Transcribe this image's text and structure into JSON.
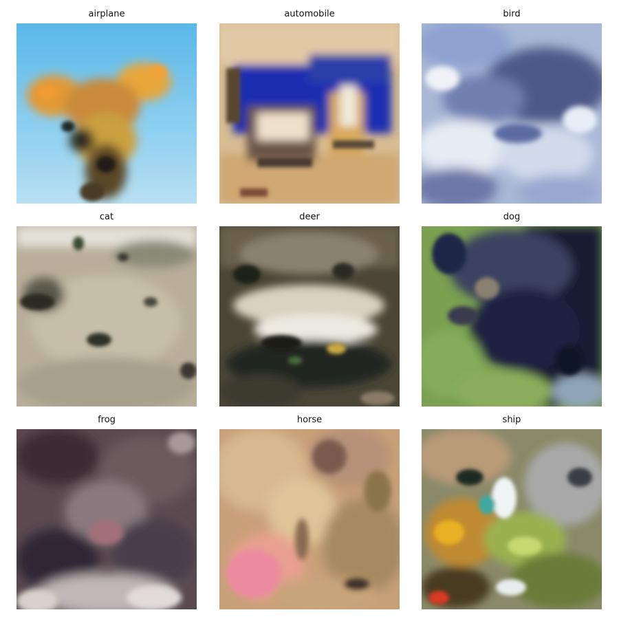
{
  "figure": {
    "panels": [
      {
        "label": "airplane"
      },
      {
        "label": "automobile"
      },
      {
        "label": "bird"
      },
      {
        "label": "cat"
      },
      {
        "label": "deer"
      },
      {
        "label": "dog"
      },
      {
        "label": "frog"
      },
      {
        "label": "horse"
      },
      {
        "label": "ship"
      }
    ]
  }
}
